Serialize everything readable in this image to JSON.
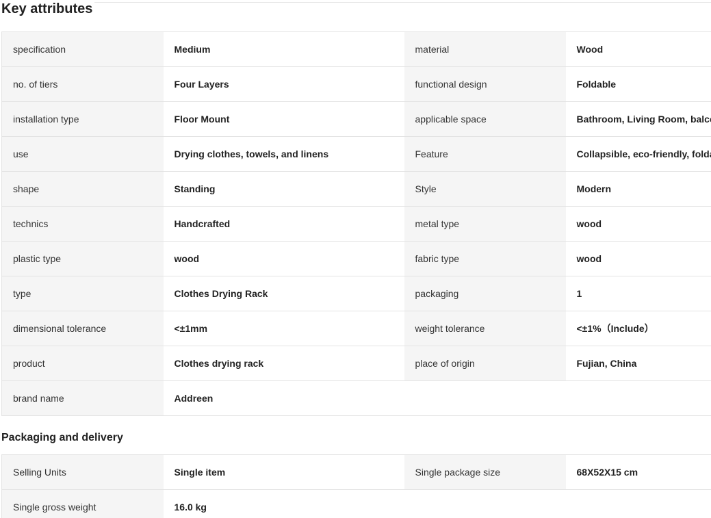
{
  "key_attributes": {
    "title": "Key attributes",
    "rows": [
      [
        {
          "label": "specification",
          "value": "Medium"
        },
        {
          "label": "material",
          "value": "Wood"
        }
      ],
      [
        {
          "label": "no. of tiers",
          "value": "Four Layers"
        },
        {
          "label": "functional design",
          "value": "Foldable"
        }
      ],
      [
        {
          "label": "installation type",
          "value": "Floor Mount"
        },
        {
          "label": "applicable space",
          "value": "Bathroom, Living Room, balcony"
        }
      ],
      [
        {
          "label": "use",
          "value": "Drying clothes, towels, and linens"
        },
        {
          "label": "Feature",
          "value": "Collapsible, eco-friendly, foldable"
        }
      ],
      [
        {
          "label": "shape",
          "value": "Standing"
        },
        {
          "label": "Style",
          "value": "Modern"
        }
      ],
      [
        {
          "label": "technics",
          "value": "Handcrafted"
        },
        {
          "label": "metal type",
          "value": "wood"
        }
      ],
      [
        {
          "label": "plastic type",
          "value": "wood"
        },
        {
          "label": "fabric type",
          "value": "wood"
        }
      ],
      [
        {
          "label": "type",
          "value": "Clothes Drying Rack"
        },
        {
          "label": "packaging",
          "value": "1"
        }
      ],
      [
        {
          "label": "dimensional tolerance",
          "value": "<±1mm"
        },
        {
          "label": "weight tolerance",
          "value": "<±1%（Include）"
        }
      ],
      [
        {
          "label": "product",
          "value": "Clothes drying rack"
        },
        {
          "label": "place of origin",
          "value": "Fujian, China"
        }
      ],
      [
        {
          "label": "brand name",
          "value": "Addreen"
        },
        {
          "label": "",
          "value": ""
        }
      ]
    ]
  },
  "packaging_delivery": {
    "title": "Packaging and delivery",
    "rows": [
      [
        {
          "label": "Selling Units",
          "value": "Single item"
        },
        {
          "label": "Single package size",
          "value": "68X52X15 cm"
        }
      ],
      [
        {
          "label": "Single gross weight",
          "value": "16.0 kg"
        },
        {
          "label": "",
          "value": ""
        }
      ]
    ]
  }
}
